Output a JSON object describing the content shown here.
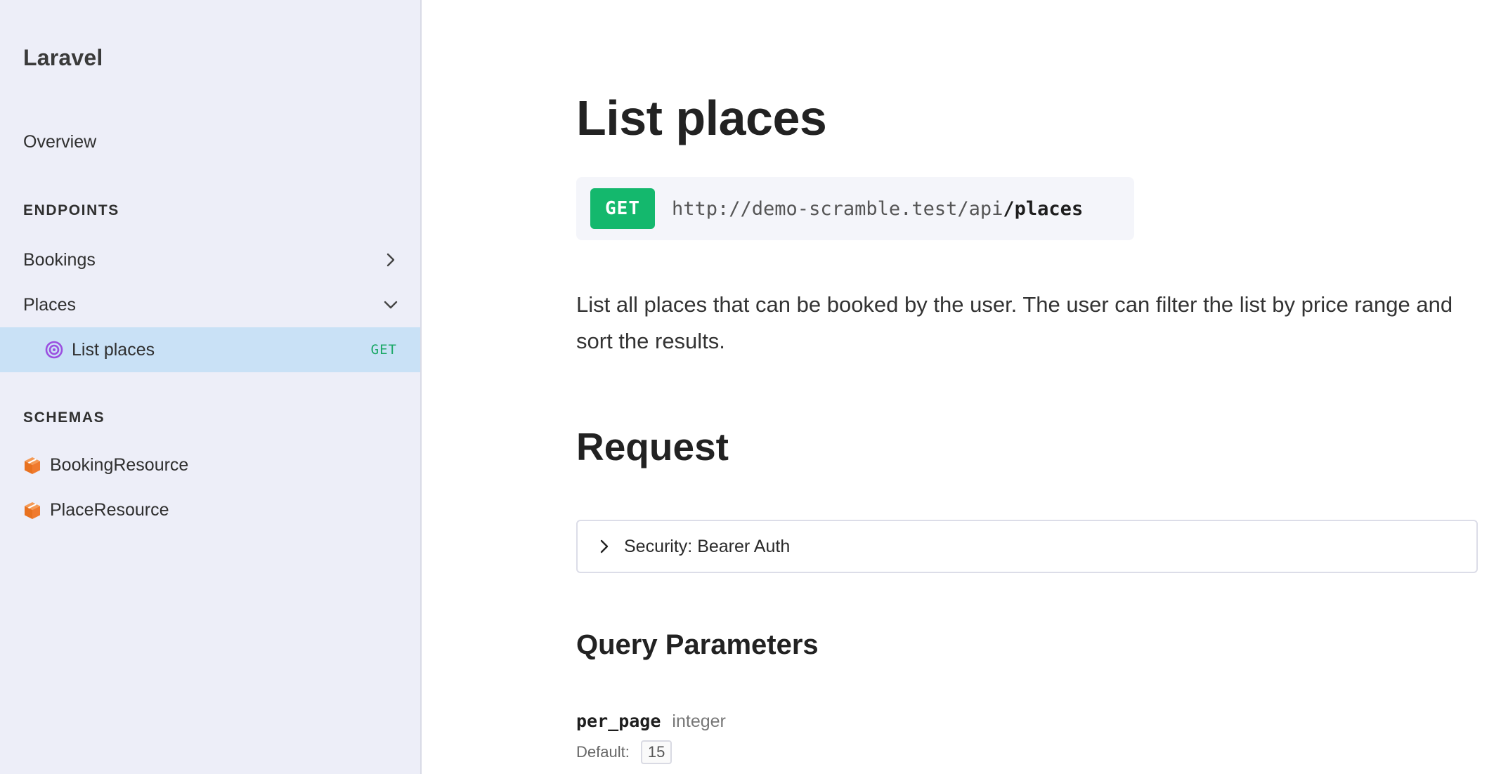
{
  "sidebar": {
    "brand": "Laravel",
    "overview_label": "Overview",
    "endpoints_label": "ENDPOINTS",
    "groups": [
      {
        "label": "Bookings",
        "chevron": "chevron-right-icon"
      },
      {
        "label": "Places",
        "chevron": "chevron-down-icon"
      }
    ],
    "active_item": {
      "label": "List places",
      "method": "GET",
      "icon": "target-icon"
    },
    "schemas_label": "SCHEMAS",
    "schemas": [
      {
        "label": "BookingResource",
        "icon": "cube-icon"
      },
      {
        "label": "PlaceResource",
        "icon": "cube-icon"
      }
    ]
  },
  "main": {
    "title": "List places",
    "method": "GET",
    "url_base": "http://demo-scramble.test/api",
    "url_path": "/places",
    "description": "List all places that can be booked by the user. The user can filter the list by price range and sort the results.",
    "request_heading": "Request",
    "security_label": "Security: Bearer Auth",
    "query_heading": "Query Parameters",
    "params": [
      {
        "name": "per_page",
        "type": "integer",
        "default_label": "Default:",
        "default_value": "15"
      }
    ]
  },
  "colors": {
    "sidebar_bg": "#edeef8",
    "active_bg": "#c9e1f6",
    "get_green": "#14b86d",
    "target_purple": "#9b4fe0",
    "cube_orange": "#f07a2e"
  }
}
